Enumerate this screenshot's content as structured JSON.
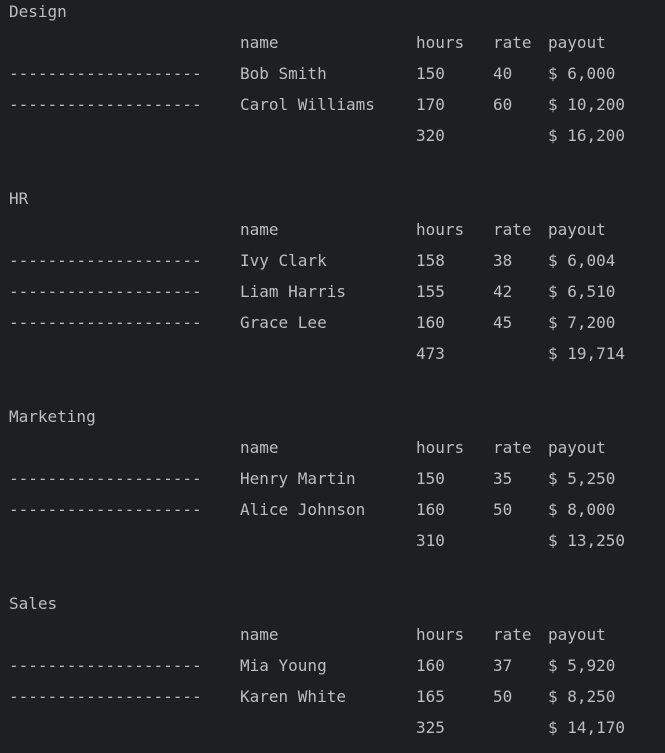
{
  "header": {
    "name": "name",
    "hours": "hours",
    "rate": "rate",
    "payout": "payout"
  },
  "groups": [
    {
      "title": "Design",
      "rows": [
        {
          "dashes": "--------------------",
          "name": "Bob Smith",
          "hours": "150",
          "rate": "40",
          "payout": "$ 6,000"
        },
        {
          "dashes": "--------------------",
          "name": "Carol Williams",
          "hours": "170",
          "rate": "60",
          "payout": "$ 10,200"
        }
      ],
      "total_hours": "320",
      "total_payout": "$ 16,200"
    },
    {
      "title": "HR",
      "rows": [
        {
          "dashes": "--------------------",
          "name": "Ivy Clark",
          "hours": "158",
          "rate": "38",
          "payout": "$ 6,004"
        },
        {
          "dashes": "--------------------",
          "name": "Liam Harris",
          "hours": "155",
          "rate": "42",
          "payout": "$ 6,510"
        },
        {
          "dashes": "--------------------",
          "name": "Grace Lee",
          "hours": "160",
          "rate": "45",
          "payout": "$ 7,200"
        }
      ],
      "total_hours": "473",
      "total_payout": "$ 19,714"
    },
    {
      "title": "Marketing",
      "rows": [
        {
          "dashes": "--------------------",
          "name": "Henry Martin",
          "hours": "150",
          "rate": "35",
          "payout": "$ 5,250"
        },
        {
          "dashes": "--------------------",
          "name": "Alice Johnson",
          "hours": "160",
          "rate": "50",
          "payout": "$ 8,000"
        }
      ],
      "total_hours": "310",
      "total_payout": "$ 13,250"
    },
    {
      "title": "Sales",
      "rows": [
        {
          "dashes": "--------------------",
          "name": "Mia Young",
          "hours": "160",
          "rate": "37",
          "payout": "$ 5,920"
        },
        {
          "dashes": "--------------------",
          "name": "Karen White",
          "hours": "165",
          "rate": "50",
          "payout": "$ 8,250"
        }
      ],
      "total_hours": "325",
      "total_payout": "$ 14,170"
    }
  ]
}
